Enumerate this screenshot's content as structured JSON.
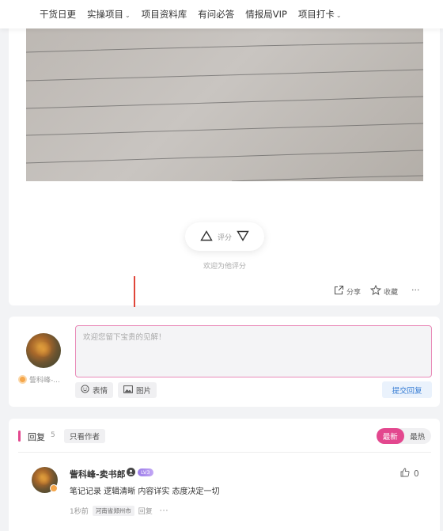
{
  "nav": {
    "items": [
      {
        "label": "干货日更",
        "has_caret": false
      },
      {
        "label": "实操项目",
        "has_caret": true
      },
      {
        "label": "项目资料库",
        "has_caret": false
      },
      {
        "label": "有问必答",
        "has_caret": false
      },
      {
        "label": "情报局VIP",
        "has_caret": false
      },
      {
        "label": "项目打卡",
        "has_caret": true
      }
    ],
    "caret": "⌄"
  },
  "post": {
    "rating_label": "评分",
    "rating_hint": "欢迎为他评分",
    "share_label": "分享",
    "favorite_label": "收藏",
    "more_label": "···"
  },
  "compose": {
    "placeholder": "欢迎您留下宝贵的见解！",
    "user_name": "訾科峰-...",
    "emoji_label": "表情",
    "image_label": "图片",
    "submit_label": "提交回复"
  },
  "replies": {
    "title": "回复",
    "count": "5",
    "only_author_label": "只看作者",
    "sort_newest": "最新",
    "sort_hottest": "最热",
    "accent_color": "#e3478e"
  },
  "comment": {
    "author": "訾科峰-卖书郎",
    "level_badge": "LV3",
    "text": "笔记记录 逻辑清晰  内容详实  态度决定一切",
    "time": "1秒前",
    "location": "河南省郑州市",
    "reply_label": "回复",
    "more_label": "···",
    "like_count": "0"
  }
}
